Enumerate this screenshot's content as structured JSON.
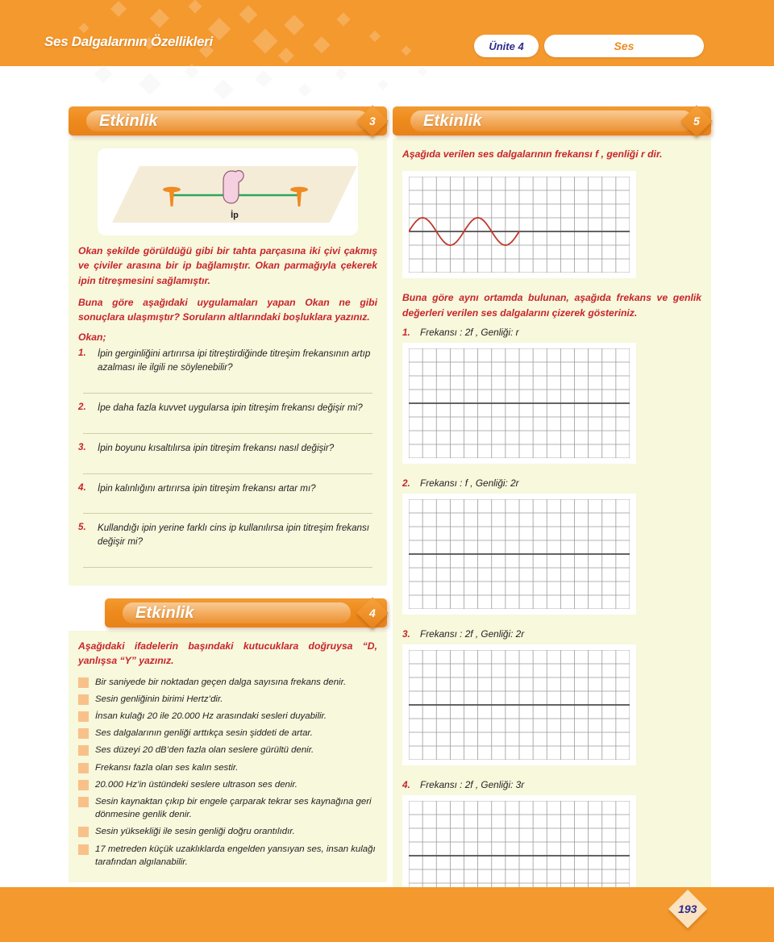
{
  "header": {
    "chapter_title": "Ses Dalgalarının Özellikleri",
    "unit_pill": "Ünite 4",
    "topic_pill": "Ses",
    "band_color": "#f4992e"
  },
  "footer": {
    "page_number": "193"
  },
  "activity3": {
    "label": "Etkinlik",
    "badge": "3",
    "illustration": {
      "string_label": "İp",
      "string_color": "#2aa85a",
      "nail_color": "#ef8b20",
      "board_color": "#f5ecd8"
    },
    "intro1": "Okan şekilde görüldüğü gibi bir tahta parçasına iki çivi çakmış ve çiviler arasına bir ip bağlamıştır. Okan parmağıyla çekerek ipin titreşmesini sağlamıştır.",
    "intro2": "Buna göre aşağıdaki uygulamaları yapan Okan ne gibi sonuçlara ulaşmıştır? Soruların altlarındaki boşluklara yazınız.",
    "actor_label": "Okan;",
    "questions": [
      {
        "num": "1.",
        "text": "İpin gerginliğini artırırsa ipi titreştirdiğinde titreşim  frekansının artıp azalması ile ilgili ne söylenebilir?"
      },
      {
        "num": "2.",
        "text": "İpe daha fazla kuvvet uygularsa ipin titreşim frekansı değişir mi?"
      },
      {
        "num": "3.",
        "text": "İpin boyunu kısaltılırsa ipin titreşim frekansı nasıl değişir?"
      },
      {
        "num": "4.",
        "text": "İpin kalınlığını artırırsa  ipin titreşim frekansı artar mı?"
      },
      {
        "num": "5.",
        "text": "Kullandığı ipin yerine farklı cins ip kullanılırsa ipin titreşim frekansı değişir mi?"
      }
    ]
  },
  "activity4": {
    "label": "Etkinlik",
    "badge": "4",
    "instruction": "Aşağıdaki ifadelerin başındaki kutucuklara doğruysa “D, yanlışsa “Y” yazınız.",
    "statements": [
      "Bir saniyede bir noktadan geçen dalga sayısına frekans denir.",
      "Sesin genliğinin birimi Hertz’dir.",
      "İnsan kulağı 20 ile 20.000 Hz arasındaki sesleri duyabilir.",
      "Ses dalgalarının genliği arttıkça sesin şiddeti de artar.",
      "Ses düzeyi 20 dB’den fazla olan seslere gürültü denir.",
      "Frekansı fazla olan ses kalın sestir.",
      "20.000 Hz’in üstündeki seslere ultrason ses denir.",
      "Sesin kaynaktan çıkıp bir engele çarparak tekrar ses kaynağına geri dönmesine genlik denir.",
      "Sesin yüksekliği ile sesin genliği doğru orantılıdır.",
      "17 metreden küçük uzaklıklarda engelden yansıyan ses, insan kulağı tarafından algılanabilir."
    ]
  },
  "activity5": {
    "label": "Etkinlik",
    "badge": "5",
    "intro": "Aşağıda verilen ses dalgalarının frekansı f , genliği r dir.",
    "instruction": "Buna göre aynı ortamda bulunan, aşağıda frekans ve genlik değerleri verilen ses dalgalarını çizerek gösteriniz.",
    "reference_wave": {
      "cols": 16,
      "rows": 7,
      "axis_row": 4,
      "cycles": 2,
      "amplitude_cells": 1,
      "span_cells": 8,
      "wave_color": "#c0392b",
      "axis_color": "#4d4d4d",
      "grid_color": "#9a9a9a"
    },
    "items": [
      {
        "num": "1.",
        "text": "Frekansı : 2f , Genliği: r",
        "cols": 16,
        "rows": 8,
        "axis_row": 4
      },
      {
        "num": "2.",
        "text": "Frekansı : f , Genliği: 2r",
        "cols": 16,
        "rows": 8,
        "axis_row": 4
      },
      {
        "num": "3.",
        "text": "Frekansı : 2f , Genliği: 2r",
        "cols": 16,
        "rows": 8,
        "axis_row": 4
      },
      {
        "num": "4.",
        "text": "Frekansı : 2f , Genliği: 3r",
        "cols": 16,
        "rows": 8,
        "axis_row": 4
      }
    ]
  }
}
